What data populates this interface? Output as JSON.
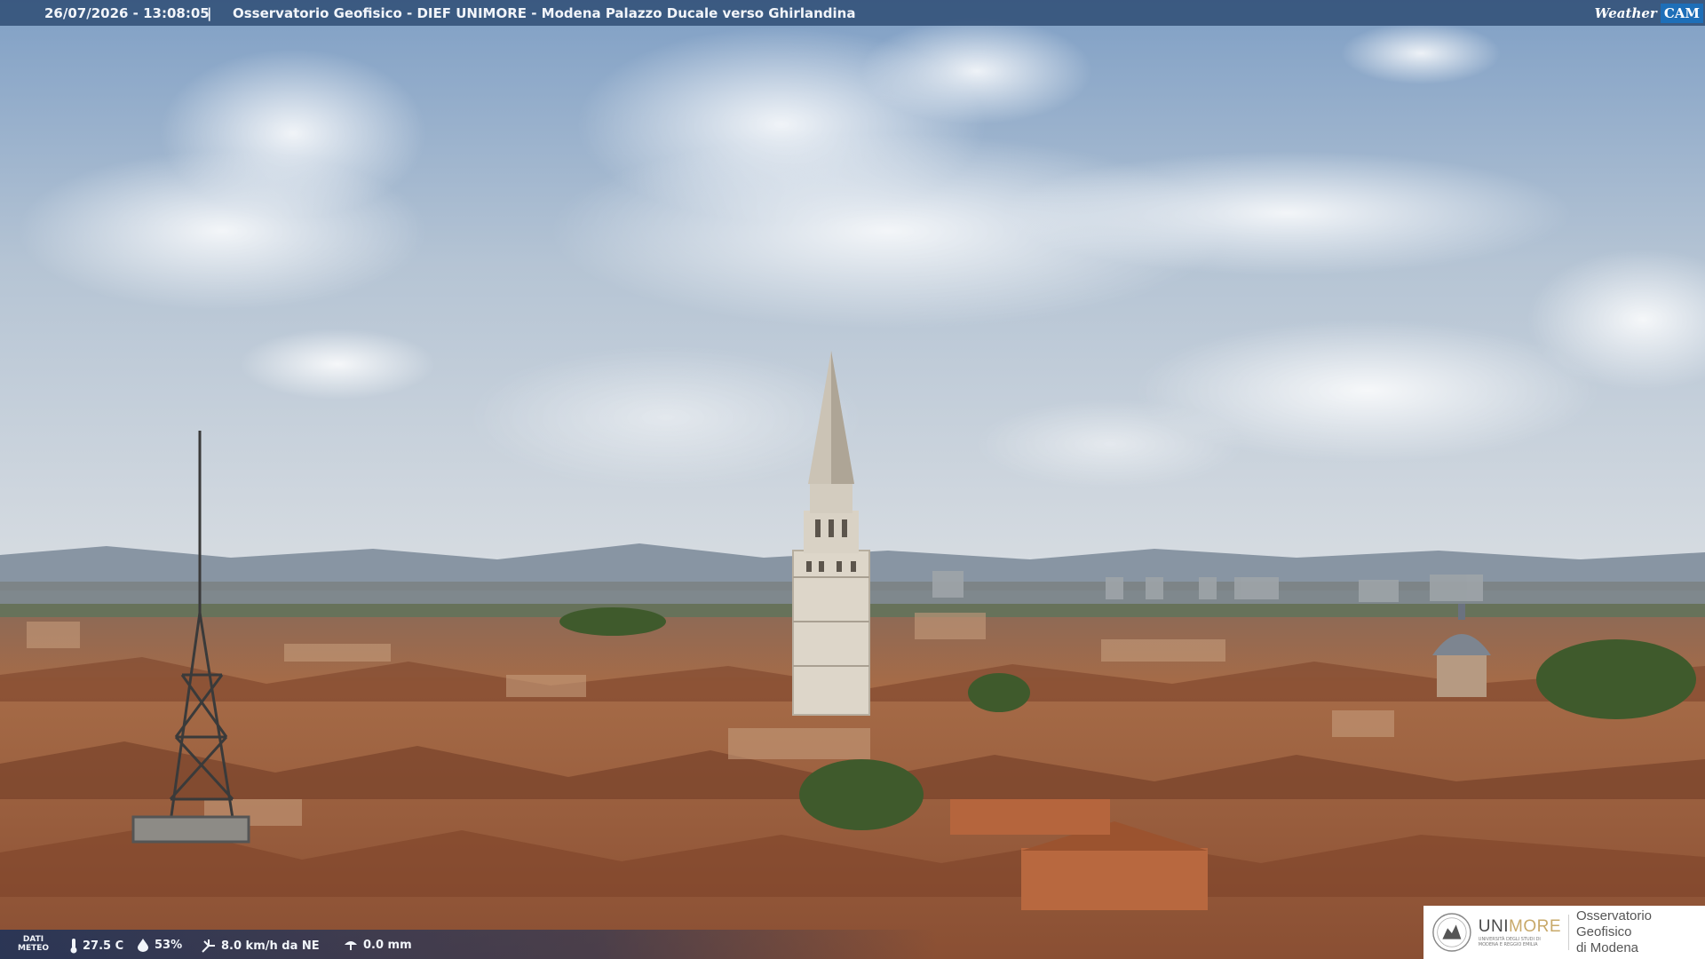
{
  "overlay": {
    "timestamp": "26/07/2026 - 13:08:05",
    "separator": "|",
    "title": "Osservatorio Geofisico - DIEF UNIMORE - Modena Palazzo Ducale verso Ghirlandina",
    "logo": {
      "weather": "Weather",
      "cam": "CAM"
    }
  },
  "weather_bar": {
    "label_line1": "DATI",
    "label_line2": "METEO",
    "temperature": "27.5 C",
    "humidity": "53%",
    "wind": "8.0 km/h da NE",
    "rain": "0.0 mm",
    "icons": [
      "thermometer-icon",
      "humidity-drop-icon",
      "wind-icon",
      "rain-icon"
    ]
  },
  "branding": {
    "university": "UNIMORE",
    "university_accent": "MORE",
    "university_sub_line1": "UNIVERSITÀ DEGLI STUDI DI",
    "university_sub_line2": "MODENA E REGGIO EMILIA",
    "observatory_line1": "Osservatorio Geofisico",
    "observatory_line2": "di Modena"
  },
  "colors": {
    "sky_top": "#7f9fc5",
    "sky_bottom": "#d6dde3",
    "roofs": "#a0603e",
    "tower": "#d9d2c5",
    "overlay_bar": "#304e76"
  }
}
